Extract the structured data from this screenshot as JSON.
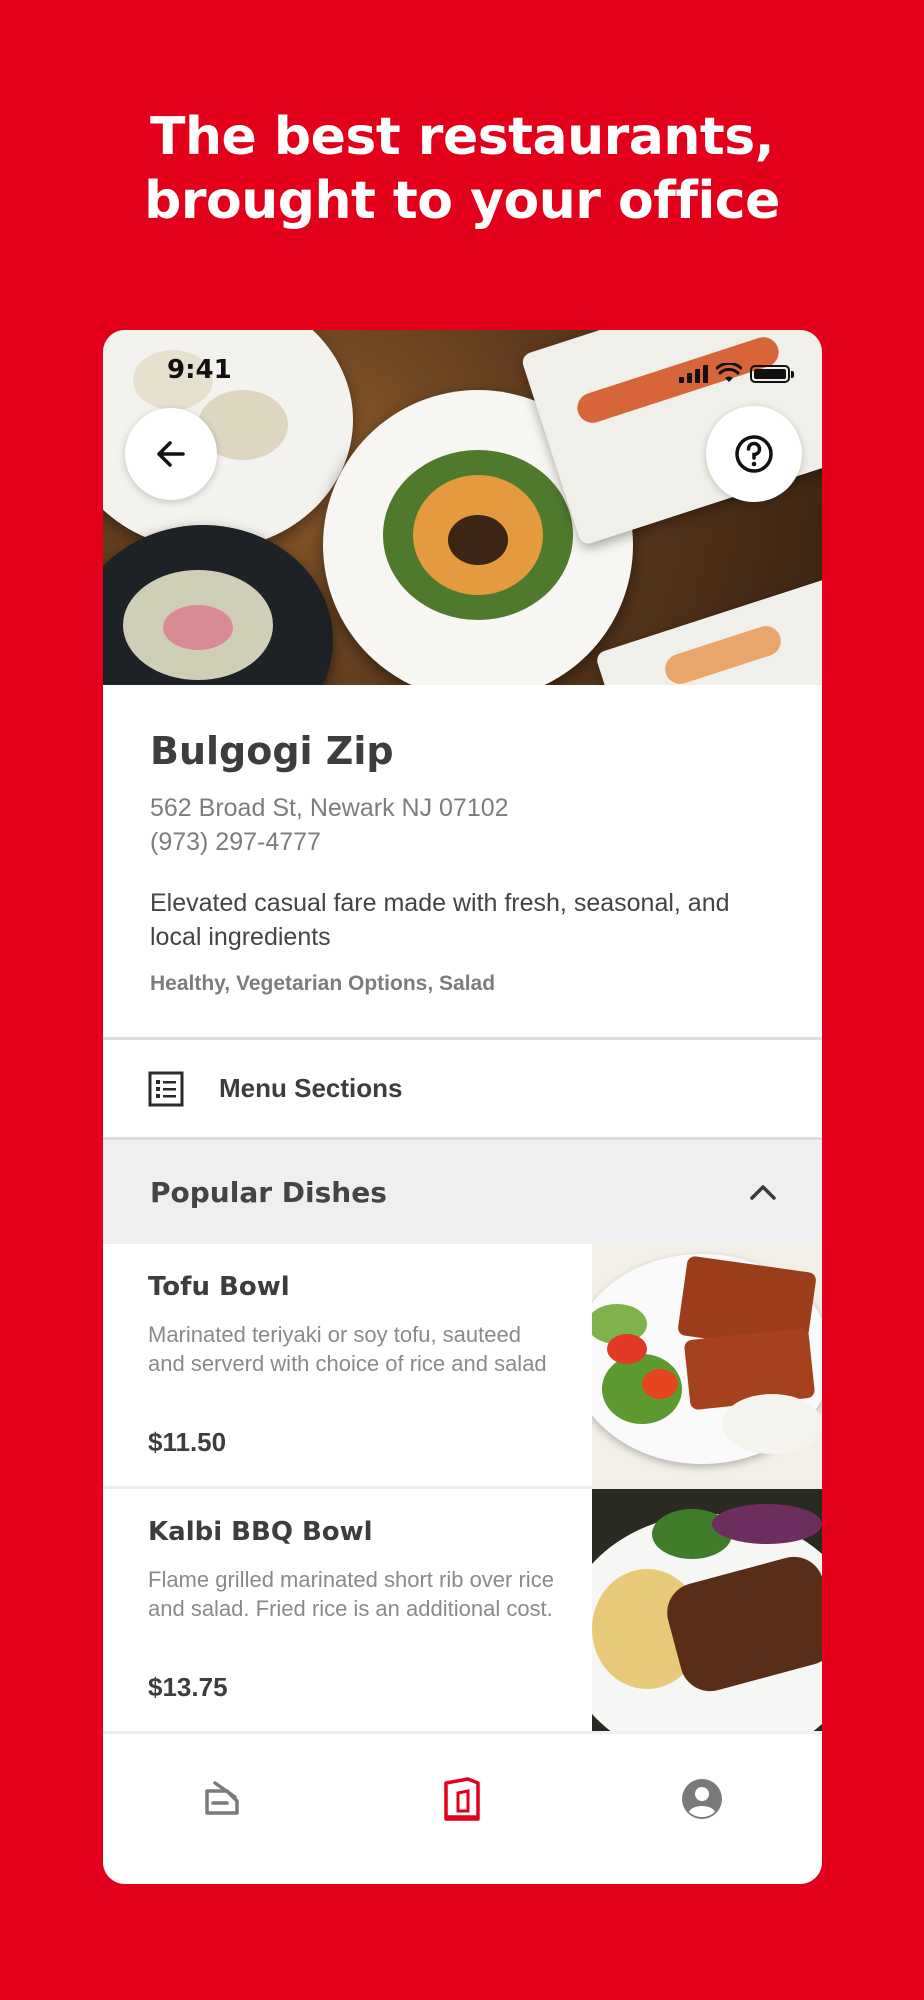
{
  "headline": {
    "line1": "The best restaurants,",
    "line2": "brought to your office"
  },
  "status_bar": {
    "time": "9:41"
  },
  "restaurant": {
    "name": "Bulgogi Zip",
    "address": "562 Broad St, Newark NJ 07102",
    "phone": "(973) 297-4777",
    "description": "Elevated casual fare made with fresh, seasonal, and local ingredients",
    "tags": "Healthy, Vegetarian Options, Salad"
  },
  "menu_sections": {
    "label": "Menu Sections"
  },
  "popular": {
    "label": "Popular Dishes"
  },
  "dishes": [
    {
      "name": "Tofu Bowl",
      "description": "Marinated teriyaki or soy tofu, sauteed and serverd with choice of rice and salad",
      "price": "$11.50"
    },
    {
      "name": "Kalbi BBQ Bowl",
      "description": "Flame grilled marinated short rib over rice and salad. Fried rice is an additional cost.",
      "price": "$13.75"
    }
  ],
  "colors": {
    "brand": "#E2001A",
    "tab_active": "#E2001A",
    "tab_inactive": "#7a7a7a"
  },
  "icons": {
    "back": "arrow-left-icon",
    "help": "question-circle-icon",
    "menu_sections": "list-icon",
    "collapse": "chevron-up-icon"
  }
}
